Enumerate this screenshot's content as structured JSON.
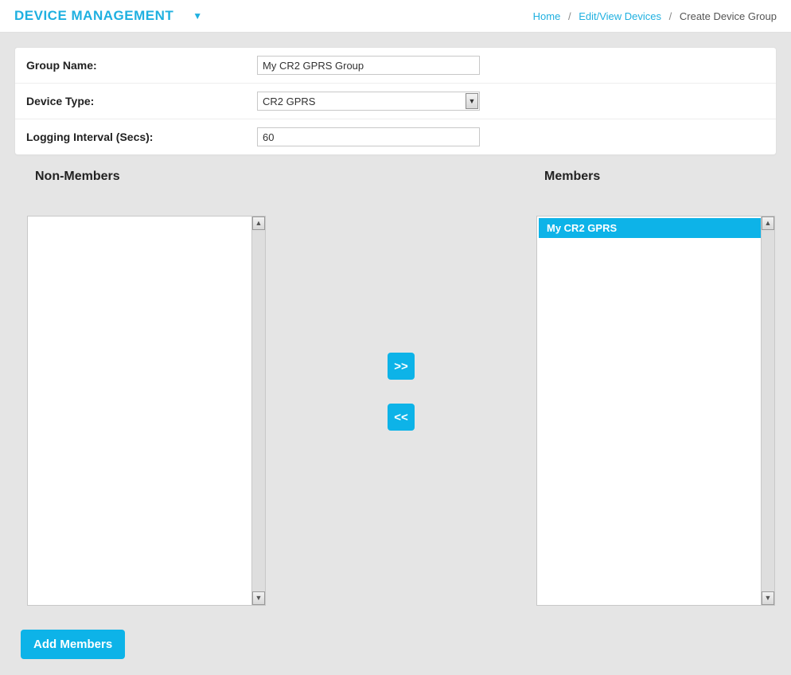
{
  "header": {
    "title": "DEVICE MANAGEMENT",
    "caret": "▼"
  },
  "breadcrumb": {
    "home": "Home",
    "mid": "Edit/View Devices",
    "current": "Create Device Group",
    "sep": "/"
  },
  "form": {
    "group_name_label": "Group Name:",
    "group_name_value": "My CR2 GPRS Group",
    "device_type_label": "Device Type:",
    "device_type_value": "CR2 GPRS",
    "logging_interval_label": "Logging Interval (Secs):",
    "logging_interval_value": "60"
  },
  "lists": {
    "non_members_title": "Non-Members",
    "members_title": "Members",
    "non_members": [],
    "members": [
      {
        "label": "My CR2 GPRS"
      }
    ]
  },
  "movers": {
    "add": ">>",
    "remove": "<<"
  },
  "scroll": {
    "up": "▲",
    "down": "▼"
  },
  "actions": {
    "add_members": "Add Members"
  }
}
